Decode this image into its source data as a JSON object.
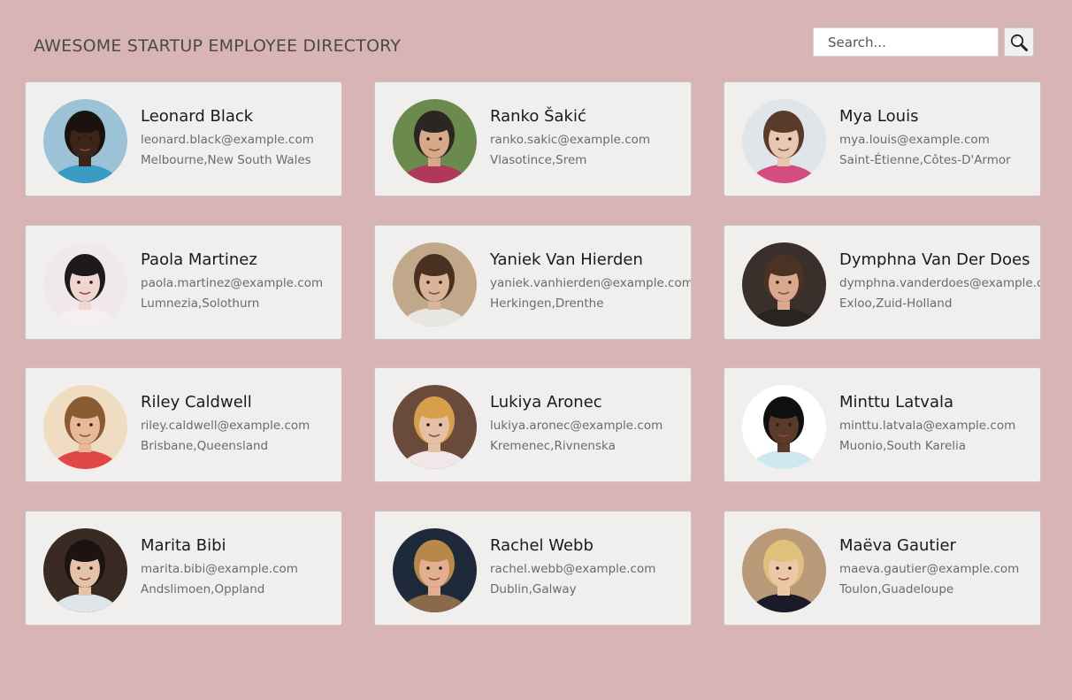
{
  "header": {
    "title": "AWESOME STARTUP EMPLOYEE DIRECTORY"
  },
  "search": {
    "placeholder": "Search...",
    "button_icon": "magnifier-icon"
  },
  "employees": [
    {
      "name": "Leonard Black",
      "email": "leonard.black@example.com",
      "location": "Melbourne,New South Wales",
      "photo": {
        "bg": "#9cc2d8",
        "skin": "#3b2518",
        "hair": "#1a120c",
        "shirt": "#3a9bc4"
      }
    },
    {
      "name": "Ranko Šakić",
      "email": "ranko.sakic@example.com",
      "location": "Vlasotince,Srem",
      "photo": {
        "bg": "#6b8a4e",
        "skin": "#d6a98a",
        "hair": "#2b2622",
        "shirt": "#b0385a"
      }
    },
    {
      "name": "Mya Louis",
      "email": "mya.louis@example.com",
      "location": "Saint-Étienne,Côtes-D'Armor",
      "photo": {
        "bg": "#dfe5e8",
        "skin": "#e8c7b0",
        "hair": "#5a3a2a",
        "shirt": "#d44d80"
      }
    },
    {
      "name": "Paola Martinez",
      "email": "paola.martinez@example.com",
      "location": "Lumnezia,Solothurn",
      "photo": {
        "bg": "#f1e8ea",
        "skin": "#efd6d0",
        "hair": "#1e1a1c",
        "shirt": "#f5f0f0"
      }
    },
    {
      "name": "Yaniek Van Hierden",
      "email": "yaniek.vanhierden@example.com",
      "location": "Herkingen,Drenthe",
      "photo": {
        "bg": "#c2a88a",
        "skin": "#d9b39a",
        "hair": "#4a3020",
        "shirt": "#e8e6e3"
      }
    },
    {
      "name": "Dymphna Van Der Does",
      "email": "dymphna.vanderdoes@example.com",
      "location": "Exloo,Zuid-Holland",
      "photo": {
        "bg": "#3a2f2a",
        "skin": "#d9a88e",
        "hair": "#4a3224",
        "shirt": "#2a2420"
      }
    },
    {
      "name": "Riley Caldwell",
      "email": "riley.caldwell@example.com",
      "location": "Brisbane,Queensland",
      "photo": {
        "bg": "#f0dcc0",
        "skin": "#e8b89a",
        "hair": "#8a5a30",
        "shirt": "#e04848"
      }
    },
    {
      "name": "Lukiya Aronec",
      "email": "lukiya.aronec@example.com",
      "location": "Kremenec,Rivnenska",
      "photo": {
        "bg": "#6a4a3a",
        "skin": "#e6c0a4",
        "hair": "#d6a04a",
        "shirt": "#f0e8e8"
      }
    },
    {
      "name": "Minttu Latvala",
      "email": "minttu.latvala@example.com",
      "location": "Muonio,South Karelia",
      "photo": {
        "bg": "#ffffff",
        "skin": "#5a3a28",
        "hair": "#101010",
        "shirt": "#cfe8f0"
      }
    },
    {
      "name": "Marita Bibi",
      "email": "marita.bibi@example.com",
      "location": "Andslimoen,Oppland",
      "photo": {
        "bg": "#3a2a24",
        "skin": "#e4c4a8",
        "hair": "#1c1410",
        "shirt": "#dfe4e8"
      }
    },
    {
      "name": "Rachel Webb",
      "email": "rachel.webb@example.com",
      "location": "Dublin,Galway",
      "photo": {
        "bg": "#1e2a3a",
        "skin": "#e2b090",
        "hair": "#b8884a",
        "shirt": "#8a6a4a"
      }
    },
    {
      "name": "Maëva Gautier",
      "email": "maeva.gautier@example.com",
      "location": "Toulon,Guadeloupe",
      "photo": {
        "bg": "#b89a78",
        "skin": "#ecc8a8",
        "hair": "#e0c07a",
        "shirt": "#1a1a2a"
      }
    }
  ]
}
